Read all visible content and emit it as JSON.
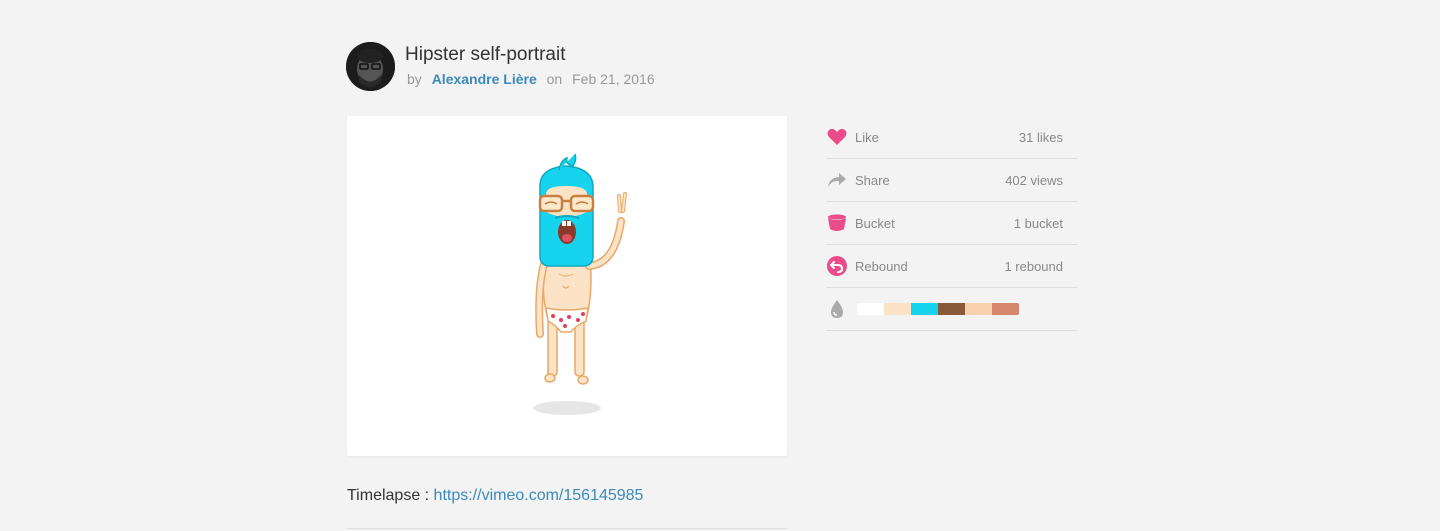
{
  "shot": {
    "title": "Hipster self-portrait",
    "by_label": "by",
    "author": "Alexandre Lière",
    "on_label": "on",
    "date": "Feb 21, 2016"
  },
  "stats": [
    {
      "label": "Like",
      "count": "31 likes",
      "icon": "heart-icon",
      "color": "#ea4c89"
    },
    {
      "label": "Share",
      "count": "402 views",
      "icon": "share-arrow-icon",
      "color": "#999999"
    },
    {
      "label": "Bucket",
      "count": "1 bucket",
      "icon": "bucket-icon",
      "color": "#ea4c89"
    },
    {
      "label": "Rebound",
      "count": "1 rebound",
      "icon": "rebound-icon",
      "color": "#ea4c89"
    }
  ],
  "palette": {
    "icon": "color-drop-icon",
    "colors": [
      "#ffffff",
      "#fbe2c7",
      "#16d4ee",
      "#8a5a38",
      "#f7d2ad",
      "#d6866a"
    ]
  },
  "description": {
    "prefix": "Timelapse : ",
    "link": "https://vimeo.com/156145985"
  }
}
